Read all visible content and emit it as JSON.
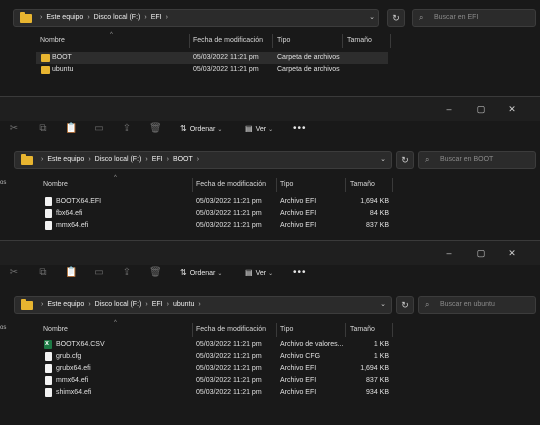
{
  "windows": [
    {
      "address": {
        "parts": [
          "Este equipo",
          "Disco local (F:)",
          "EFI"
        ]
      },
      "search_placeholder": "Buscar en EFI",
      "columns": {
        "name": "Nombre",
        "date": "Fecha de modificación",
        "type": "Tipo",
        "size": "Tamaño"
      },
      "rows": [
        {
          "name": "BOOT",
          "date": "05/03/2022 11:21 pm",
          "type": "Carpeta de archivos",
          "size": "",
          "icon": "folder",
          "selected": true
        },
        {
          "name": "ubuntu",
          "date": "05/03/2022 11:21 pm",
          "type": "Carpeta de archivos",
          "size": "",
          "icon": "folder"
        }
      ]
    },
    {
      "toolbar": {
        "sort": "Ordenar",
        "view": "Ver",
        "more": "•••"
      },
      "address": {
        "parts": [
          "Este equipo",
          "Disco local (F:)",
          "EFI",
          "BOOT"
        ]
      },
      "search_placeholder": "Buscar en BOOT",
      "columns": {
        "name": "Nombre",
        "date": "Fecha de modificación",
        "type": "Tipo",
        "size": "Tamaño"
      },
      "left_label": "os",
      "rows": [
        {
          "name": "BOOTX64.EFI",
          "date": "05/03/2022 11:21 pm",
          "type": "Archivo EFI",
          "size": "1,694 KB",
          "icon": "doc"
        },
        {
          "name": "fbx64.efi",
          "date": "05/03/2022 11:21 pm",
          "type": "Archivo EFI",
          "size": "84 KB",
          "icon": "doc"
        },
        {
          "name": "mmx64.efi",
          "date": "05/03/2022 11:21 pm",
          "type": "Archivo EFI",
          "size": "837 KB",
          "icon": "doc"
        }
      ]
    },
    {
      "toolbar": {
        "sort": "Ordenar",
        "view": "Ver",
        "more": "•••"
      },
      "address": {
        "parts": [
          "Este equipo",
          "Disco local (F:)",
          "EFI",
          "ubuntu"
        ]
      },
      "search_placeholder": "Buscar en ubuntu",
      "columns": {
        "name": "Nombre",
        "date": "Fecha de modificación",
        "type": "Tipo",
        "size": "Tamaño"
      },
      "left_label": "os",
      "rows": [
        {
          "name": "BOOTX64.CSV",
          "date": "05/03/2022 11:21 pm",
          "type": "Archivo de valores...",
          "size": "1 KB",
          "icon": "csv"
        },
        {
          "name": "grub.cfg",
          "date": "05/03/2022 11:21 pm",
          "type": "Archivo CFG",
          "size": "1 KB",
          "icon": "doc"
        },
        {
          "name": "grubx64.efi",
          "date": "05/03/2022 11:21 pm",
          "type": "Archivo EFI",
          "size": "1,694 KB",
          "icon": "doc"
        },
        {
          "name": "mmx64.efi",
          "date": "05/03/2022 11:21 pm",
          "type": "Archivo EFI",
          "size": "837 KB",
          "icon": "doc"
        },
        {
          "name": "shimx64.efi",
          "date": "05/03/2022 11:21 pm",
          "type": "Archivo EFI",
          "size": "934 KB",
          "icon": "doc"
        }
      ]
    }
  ],
  "colors": {
    "background": "#191919",
    "folder": "#e8b530",
    "selected_row": "#2d2d2d",
    "csv_icon": "#1d7a45"
  }
}
